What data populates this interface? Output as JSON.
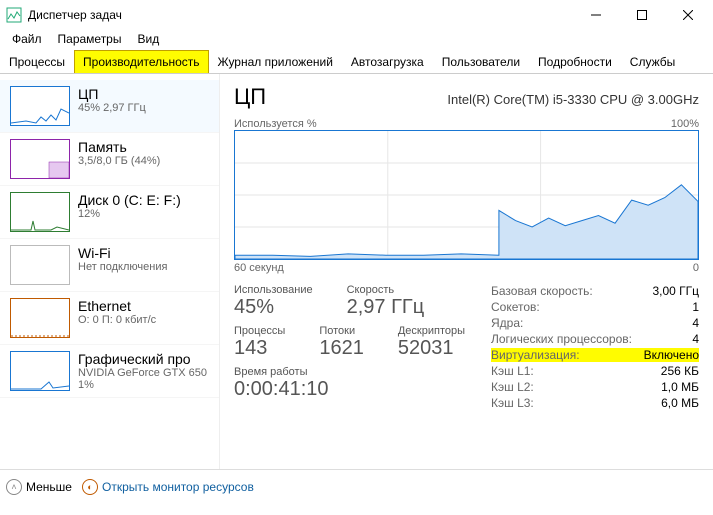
{
  "window": {
    "title": "Диспетчер задач"
  },
  "menu": {
    "file": "Файл",
    "options": "Параметры",
    "view": "Вид"
  },
  "tabs": {
    "processes": "Процессы",
    "performance": "Производительность",
    "apphistory": "Журнал приложений",
    "startup": "Автозагрузка",
    "users": "Пользователи",
    "details": "Подробности",
    "services": "Службы"
  },
  "sidebar": {
    "cpu": {
      "title": "ЦП",
      "sub": "45% 2,97 ГГц",
      "color": "#1976d2"
    },
    "mem": {
      "title": "Память",
      "sub": "3,5/8,0 ГБ (44%)",
      "color": "#8e24aa"
    },
    "disk": {
      "title": "Диск 0 (C: E: F:)",
      "sub": "12%",
      "color": "#2e7d32"
    },
    "wifi": {
      "title": "Wi-Fi",
      "sub": "Нет подключения",
      "color": "#999"
    },
    "eth": {
      "title": "Ethernet",
      "sub": "О: 0 П: 0 кбит/с",
      "color": "#c05a00"
    },
    "gpu": {
      "title": "Графический про",
      "sub": "NVIDIA GeForce GTX 650",
      "sub2": "1%",
      "color": "#1976d2"
    }
  },
  "detail": {
    "title": "ЦП",
    "model": "Intel(R) Core(TM) i5-3330 CPU @ 3.00GHz",
    "ylabel": "Используется %",
    "ymax": "100%",
    "xlabel": "60 секунд",
    "xmin": "0",
    "util_lab": "Использование",
    "util_val": "45%",
    "speed_lab": "Скорость",
    "speed_val": "2,97 ГГц",
    "proc_lab": "Процессы",
    "proc_val": "143",
    "thr_lab": "Потоки",
    "thr_val": "1621",
    "hnd_lab": "Дескрипторы",
    "hnd_val": "52031",
    "uptime_lab": "Время работы",
    "uptime_val": "0:00:41:10",
    "specs": {
      "base_l": "Базовая скорость:",
      "base_r": "3,00 ГГц",
      "sock_l": "Сокетов:",
      "sock_r": "1",
      "core_l": "Ядра:",
      "core_r": "4",
      "lproc_l": "Логических процессоров:",
      "lproc_r": "4",
      "virt_l": "Виртуализация:",
      "virt_r": "Включено",
      "l1_l": "Кэш L1:",
      "l1_r": "256 КБ",
      "l2_l": "Кэш L2:",
      "l2_r": "1,0 МБ",
      "l3_l": "Кэш L3:",
      "l3_r": "6,0 МБ"
    }
  },
  "footer": {
    "fewer": "Меньше",
    "openmon": "Открыть монитор ресурсов"
  },
  "chart_data": {
    "type": "area",
    "title": "Используется %",
    "xlabel": "60 секунд",
    "ylabel": "%",
    "ylim": [
      0,
      100
    ],
    "x": [
      0,
      5,
      10,
      15,
      20,
      25,
      30,
      35,
      40,
      45,
      50,
      55,
      60
    ],
    "values": [
      3,
      3,
      2,
      4,
      3,
      3,
      4,
      3,
      38,
      30,
      25,
      32,
      26,
      30,
      34,
      28,
      46,
      42,
      48,
      58,
      45
    ]
  }
}
